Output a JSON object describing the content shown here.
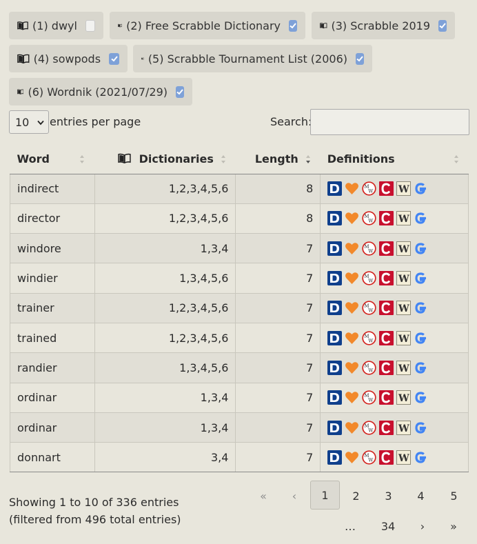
{
  "dictionaries": [
    {
      "label": "(1) dwyl",
      "checked": false
    },
    {
      "label": "(2) Free Scrabble Dictionary",
      "checked": true
    },
    {
      "label": "(3) Scrabble 2019",
      "checked": true
    },
    {
      "label": "(4) sowpods",
      "checked": true
    },
    {
      "label": "(5) Scrabble Tournament List (2006)",
      "checked": true
    },
    {
      "label": "(6) Wordnik (2021/07/29)",
      "checked": true
    }
  ],
  "length_menu": {
    "value": "10",
    "label": "entries per page"
  },
  "search": {
    "label": "Search:",
    "value": ""
  },
  "columns": {
    "word": "Word",
    "dictionaries": "Dictionaries",
    "length": "Length",
    "definitions": "Definitions"
  },
  "rows": [
    {
      "word": "indirect",
      "dicts": "1,2,3,4,5,6",
      "length": "8"
    },
    {
      "word": "director",
      "dicts": "1,2,3,4,5,6",
      "length": "8"
    },
    {
      "word": "windore",
      "dicts": "1,3,4",
      "length": "7"
    },
    {
      "word": "windier",
      "dicts": "1,3,4,5,6",
      "length": "7"
    },
    {
      "word": "trainer",
      "dicts": "1,2,3,4,5,6",
      "length": "7"
    },
    {
      "word": "trained",
      "dicts": "1,2,3,4,5,6",
      "length": "7"
    },
    {
      "word": "randier",
      "dicts": "1,3,4,5,6",
      "length": "7"
    },
    {
      "word": "ordinar",
      "dicts": "1,3,4",
      "length": "7"
    },
    {
      "word": "ordinar",
      "dicts": "1,3,4",
      "length": "7"
    },
    {
      "word": "donnart",
      "dicts": "3,4",
      "length": "7"
    }
  ],
  "definition_icons": [
    "dictionary-com-icon",
    "heart-icon",
    "merriam-webster-icon",
    "collins-icon",
    "wiktionary-icon",
    "google-icon"
  ],
  "info": "Showing 1 to 10 of 336 entries (filtered from 496 total entries)",
  "pagination": {
    "first": "«",
    "prev": "‹",
    "pages": [
      "1",
      "2",
      "3",
      "4",
      "5"
    ],
    "ellipsis": "…",
    "last_page": "34",
    "next": "›",
    "last": "»",
    "current": "1"
  },
  "colors": {
    "accent": "#7ea1d8",
    "background": "#e8e6dc",
    "chip": "#d8d6cd"
  }
}
